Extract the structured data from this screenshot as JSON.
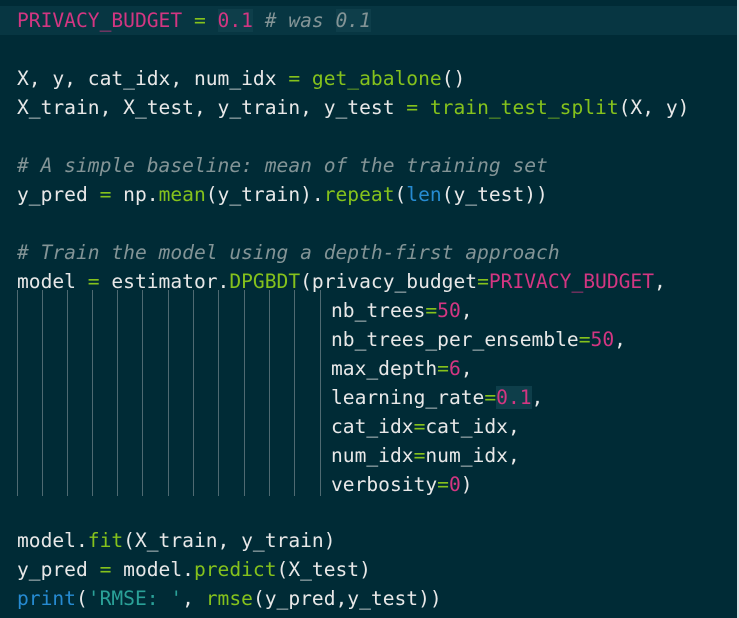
{
  "line_1": {
    "name": "PRIVACY_BUDGET",
    "op": " = ",
    "value": "0.1",
    "comment_prefix": " # was ",
    "comment_value": "0.1"
  },
  "line_3": {
    "targets": "X, y, cat_idx, num_idx",
    "op": " = ",
    "call": "get_abalone",
    "args": "()"
  },
  "line_4": {
    "targets": "X_train, X_test, y_train, y_test",
    "op": " = ",
    "call": "train_test_split",
    "args": "(X, y)"
  },
  "line_6": {
    "comment": "# A simple baseline: mean of the training set"
  },
  "line_7": {
    "target": "y_pred",
    "op": " = ",
    "obj": "np.",
    "call1": "mean",
    "args1": "(y_train).",
    "call2": "repeat",
    "paren_open": "(",
    "builtin": "len",
    "args2": "(y_test))"
  },
  "line_9": {
    "comment": "# Train the model using a depth-first approach"
  },
  "line_10": {
    "target": "model",
    "op": " = ",
    "obj": "estimator.",
    "call": "DPGBDT",
    "paren_open": "(privacy_budget",
    "eq": "=",
    "value": "PRIVACY_BUDGET",
    "trail": ","
  },
  "kwargs": [
    {
      "key": "nb_trees",
      "eq": "=",
      "value": "50",
      "trail": ",",
      "value_kind": "const"
    },
    {
      "key": "nb_trees_per_ensemble",
      "eq": "=",
      "value": "50",
      "trail": ",",
      "value_kind": "const"
    },
    {
      "key": "max_depth",
      "eq": "=",
      "value": "6",
      "trail": ",",
      "value_kind": "const"
    },
    {
      "key": "learning_rate",
      "eq": "=",
      "value": "0.1",
      "trail": ",",
      "value_kind": "num"
    },
    {
      "key": "cat_idx",
      "eq": "=",
      "value": "cat_idx",
      "trail": ",",
      "value_kind": "plain"
    },
    {
      "key": "num_idx",
      "eq": "=",
      "value": "num_idx",
      "trail": ",",
      "value_kind": "plain"
    },
    {
      "key": "verbosity",
      "eq": "=",
      "value": "0",
      "trail": ")",
      "value_kind": "const"
    }
  ],
  "line_19": {
    "obj": "model.",
    "call": "fit",
    "args": "(X_train, y_train)"
  },
  "line_20": {
    "target": "y_pred",
    "op": " = ",
    "obj": "model.",
    "call": "predict",
    "args": "(X_test)"
  },
  "line_21": {
    "builtin": "print",
    "paren_open": "(",
    "string": "'RMSE: '",
    "sep": ", ",
    "call": "rmse",
    "args": "(y_pred,y_test))"
  },
  "colors": {
    "background": "#002b36",
    "current_line": "#073642",
    "text": "#e8e8e8",
    "constant": "#d33682",
    "comment": "#839496",
    "function": "#85c21c",
    "builtin": "#268bd2",
    "string": "#2aa198"
  }
}
